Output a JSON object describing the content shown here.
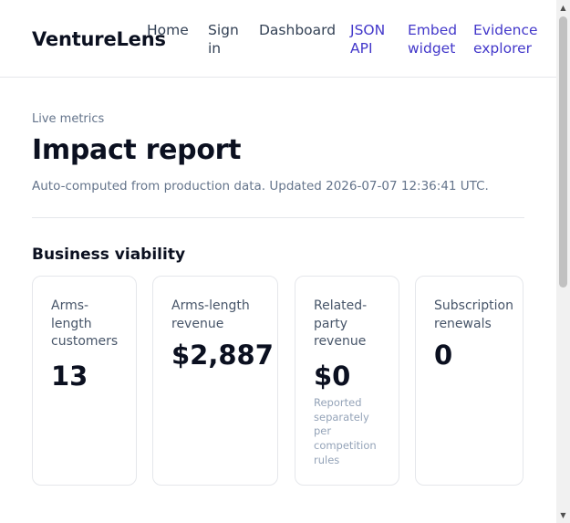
{
  "header": {
    "brand": "VentureLens",
    "nav": {
      "home": "Home",
      "sign_in": "Sign in",
      "dashboard": "Dashboard",
      "json_api": "JSON API",
      "embed_widget": "Embed widget",
      "evidence_explorer": "Evidence explorer"
    }
  },
  "main": {
    "eyebrow": "Live metrics",
    "title": "Impact report",
    "subtitle": "Auto-computed from production data. Updated 2026-07-07 12:36:41 UTC.",
    "section_title": "Business viability",
    "cards": [
      {
        "label": "Arms-length customers",
        "value": "13",
        "note": ""
      },
      {
        "label": "Arms-length revenue",
        "value": "$2,887",
        "note": ""
      },
      {
        "label": "Related-party revenue",
        "value": "$0",
        "note": "Reported separately per competition rules"
      },
      {
        "label": "Subscription renewals",
        "value": "0",
        "note": ""
      }
    ]
  },
  "scrollbar": {
    "up_icon": "up-triangle-icon",
    "down_icon": "down-triangle-icon"
  },
  "colors": {
    "accent_link": "#4338ca",
    "text_primary": "#0b1020",
    "text_muted": "#64748b",
    "border": "#e5e7eb"
  }
}
